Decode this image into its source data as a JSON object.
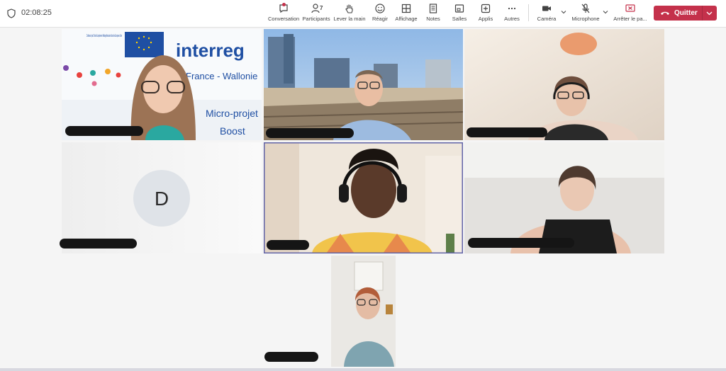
{
  "call": {
    "timer": "02:08:25"
  },
  "toolbar": {
    "conversation": "Conversation",
    "participants": "Participants",
    "participants_count": "7",
    "raise_hand": "Lever la main",
    "react": "Réagir",
    "view": "Affichage",
    "notes": "Notes",
    "rooms": "Salles",
    "apps": "Applis",
    "more": "Autres",
    "camera": "Caméra",
    "microphone": "Microphone",
    "stop_share": "Arrêter le pa...",
    "leave": "Quitter"
  },
  "tiles": {
    "tile1": {
      "flag_text": "Cofinancé par l'Union Européenne Medegefinancierd door de Europese Unie",
      "banner_word": "interreg",
      "banner_sub": "France - Wallonie",
      "banner_sub2": "Micro-projet",
      "banner_sub3": "Boost"
    },
    "tile4": {
      "avatar_initial": "D"
    }
  },
  "colors": {
    "accent": "#6264a7",
    "leave": "#c4314b",
    "avatar_bg": "#dfe3e8"
  }
}
